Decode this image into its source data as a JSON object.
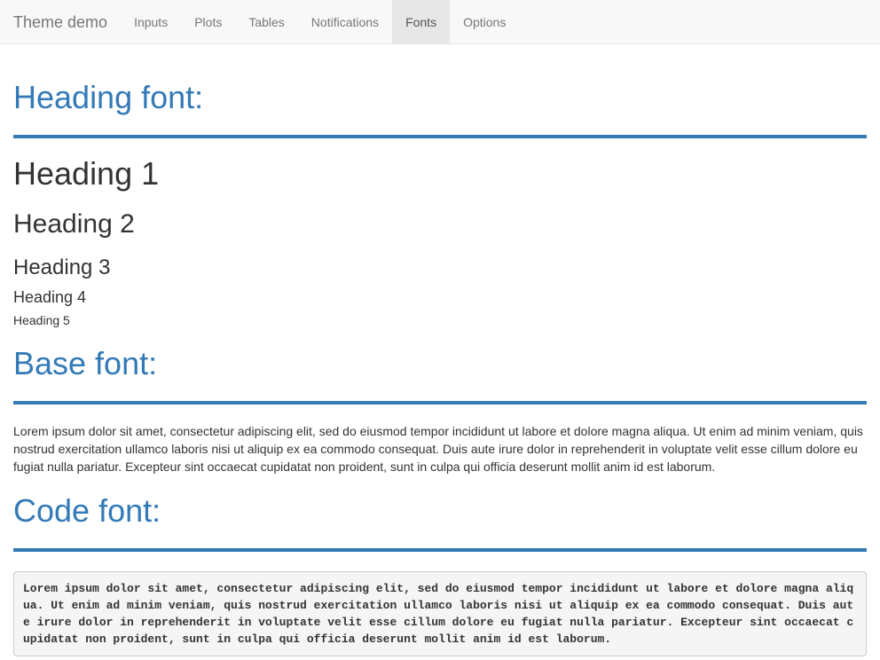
{
  "navbar": {
    "brand": "Theme demo",
    "items": [
      {
        "label": "Inputs"
      },
      {
        "label": "Plots"
      },
      {
        "label": "Tables"
      },
      {
        "label": "Notifications"
      },
      {
        "label": "Fonts"
      },
      {
        "label": "Options"
      }
    ],
    "active": "Fonts"
  },
  "sections": {
    "heading": {
      "title": "Heading font:",
      "h1": "Heading 1",
      "h2": "Heading 2",
      "h3": "Heading 3",
      "h4": "Heading 4",
      "h5": "Heading 5"
    },
    "base": {
      "title": "Base font:",
      "text": "Lorem ipsum dolor sit amet, consectetur adipiscing elit, sed do eiusmod tempor incididunt ut labore et dolore magna aliqua. Ut enim ad minim veniam, quis nostrud exercitation ullamco laboris nisi ut aliquip ex ea commodo consequat. Duis aute irure dolor in reprehenderit in voluptate velit esse cillum dolore eu fugiat nulla pariatur. Excepteur sint occaecat cupidatat non proident, sunt in culpa qui officia deserunt mollit anim id est laborum."
    },
    "code": {
      "title": "Code font:",
      "text": "Lorem ipsum dolor sit amet, consectetur adipiscing elit, sed do eiusmod tempor incididunt ut labore et dolore magna aliqua. Ut enim ad minim veniam, quis nostrud exercitation ullamco laboris nisi ut aliquip ex ea commodo consequat. Duis aute irure dolor in reprehenderit in voluptate velit esse cillum dolore eu fugiat nulla pariatur. Excepteur sint occaecat cupidatat non proident, sunt in culpa qui officia deserunt mollit anim id est laborum."
    }
  },
  "colors": {
    "accent": "#337ab7",
    "navbar_bg": "#f8f8f8",
    "nav_active_bg": "#e7e7e7",
    "text": "#333333",
    "code_bg": "#f5f5f5"
  }
}
